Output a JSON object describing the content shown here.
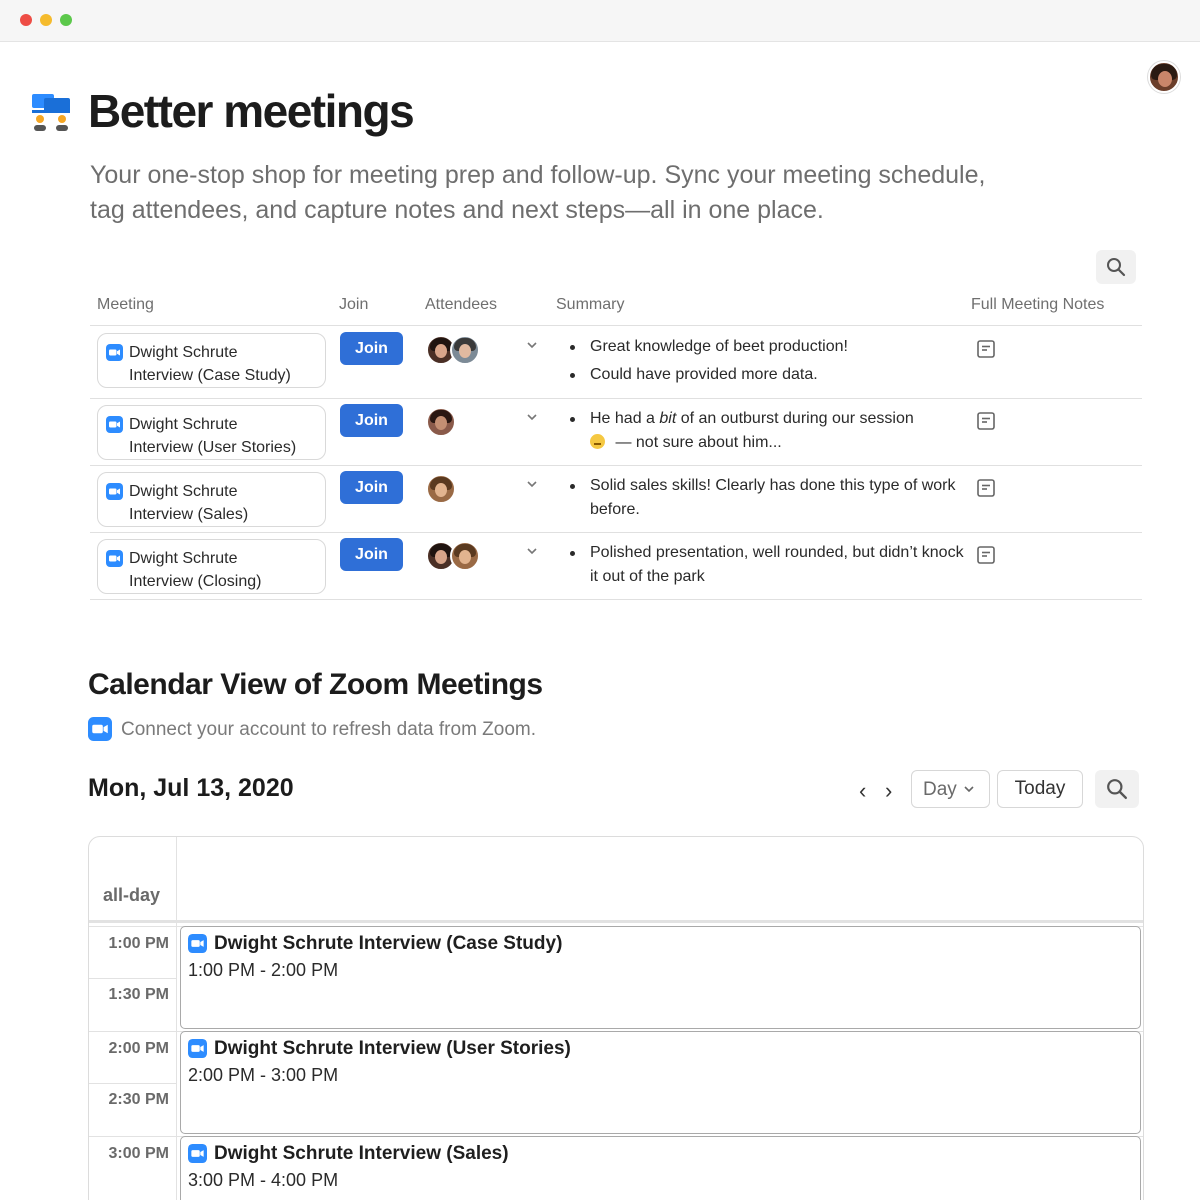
{
  "window": {
    "controls": [
      "close",
      "minimize",
      "maximize"
    ]
  },
  "header": {
    "icon": "people-meeting-icon",
    "title": "Better meetings",
    "subtitle": "Your one-stop shop for meeting prep and follow-up. Sync your meeting schedule, tag attendees, and capture notes and next steps—all in one place."
  },
  "table": {
    "columns": {
      "meeting": "Meeting",
      "join": "Join",
      "attendees": "Attendees",
      "summary": "Summary",
      "notes": "Full Meeting Notes"
    },
    "rows": [
      {
        "meeting_line1": "Dwight Schrute",
        "meeting_line2": "Interview (Case Study)",
        "join_label": "Join",
        "summary": [
          "Great knowledge of beet production!",
          "Could have provided more data."
        ]
      },
      {
        "meeting_line1": "Dwight Schrute",
        "meeting_line2": "Interview (User Stories)",
        "join_label": "Join",
        "summary_prefix": "He had a ",
        "summary_em": "bit",
        "summary_mid": " of an outburst during our session",
        "summary_end": " — not sure about him..."
      },
      {
        "meeting_line1": "Dwight Schrute",
        "meeting_line2": "Interview (Sales)",
        "join_label": "Join",
        "summary": [
          "Solid sales skills! Clearly has done this type of work before."
        ]
      },
      {
        "meeting_line1": "Dwight Schrute",
        "meeting_line2": "Interview (Closing)",
        "join_label": "Join",
        "summary": [
          "Polished presentation, well rounded, but didn’t knock it out of the park"
        ]
      }
    ]
  },
  "calendar": {
    "title": "Calendar View of Zoom Meetings",
    "connect_text": "Connect your account to refresh data from Zoom.",
    "date": "Mon, Jul 13, 2020",
    "prev": "‹",
    "next": "›",
    "view": "Day",
    "today_label": "Today",
    "allday_label": "all-day",
    "slots": [
      "1:00 PM",
      "1:30 PM",
      "2:00 PM",
      "2:30 PM",
      "3:00 PM"
    ],
    "events": [
      {
        "title": "Dwight Schrute Interview (Case Study)",
        "time": "1:00 PM - 2:00 PM"
      },
      {
        "title": "Dwight Schrute Interview (User Stories)",
        "time": "2:00 PM - 3:00 PM"
      },
      {
        "title": "Dwight Schrute Interview (Sales)",
        "time": "3:00 PM - 4:00 PM"
      }
    ]
  },
  "colors": {
    "accent": "#2f6fd7",
    "zoom": "#2d8cff"
  }
}
